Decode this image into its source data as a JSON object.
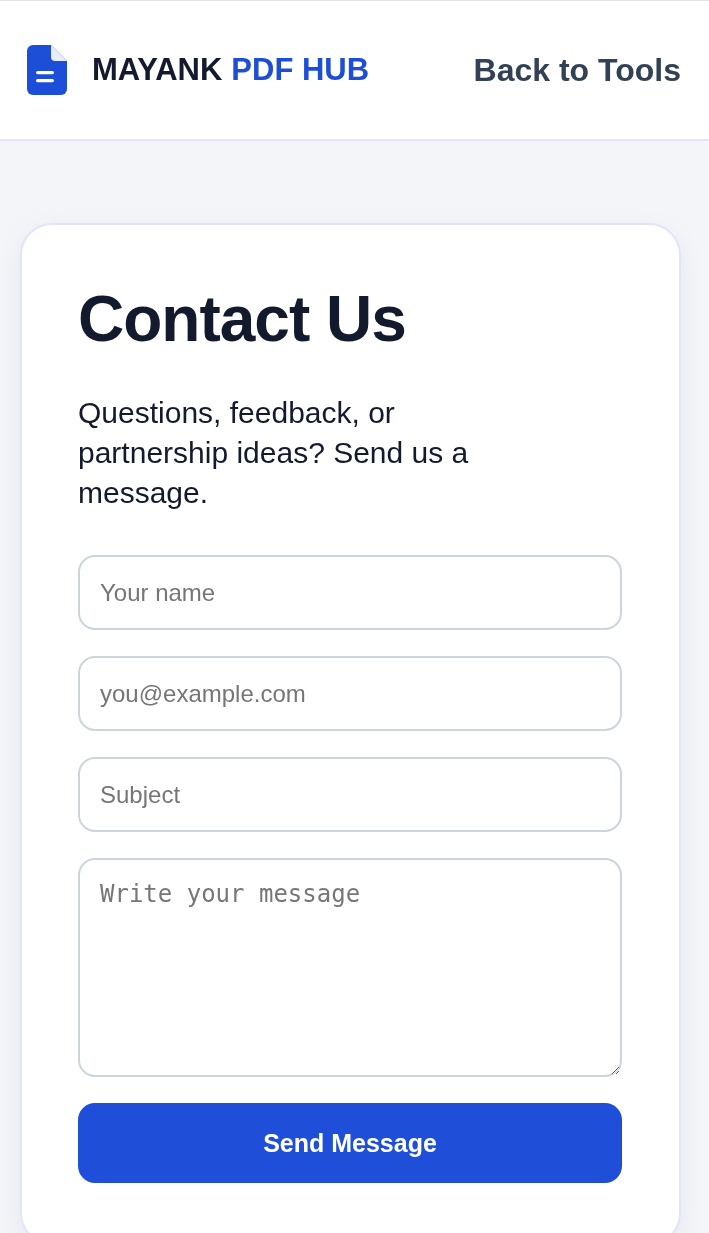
{
  "header": {
    "brand": {
      "name": "MAYANK",
      "accent": "PDF HUB"
    },
    "nav_link": "Back to Tools"
  },
  "contact": {
    "title": "Contact Us",
    "subtitle": "Questions, feedback, or partnership ideas? Send us a message.",
    "fields": [
      {
        "kind": "input",
        "placeholder": "Your name"
      },
      {
        "kind": "input",
        "placeholder": "you@example.com"
      },
      {
        "kind": "input",
        "placeholder": "Subject"
      },
      {
        "kind": "textarea",
        "placeholder": "Write your message"
      }
    ],
    "submit_button": "Send Message"
  }
}
